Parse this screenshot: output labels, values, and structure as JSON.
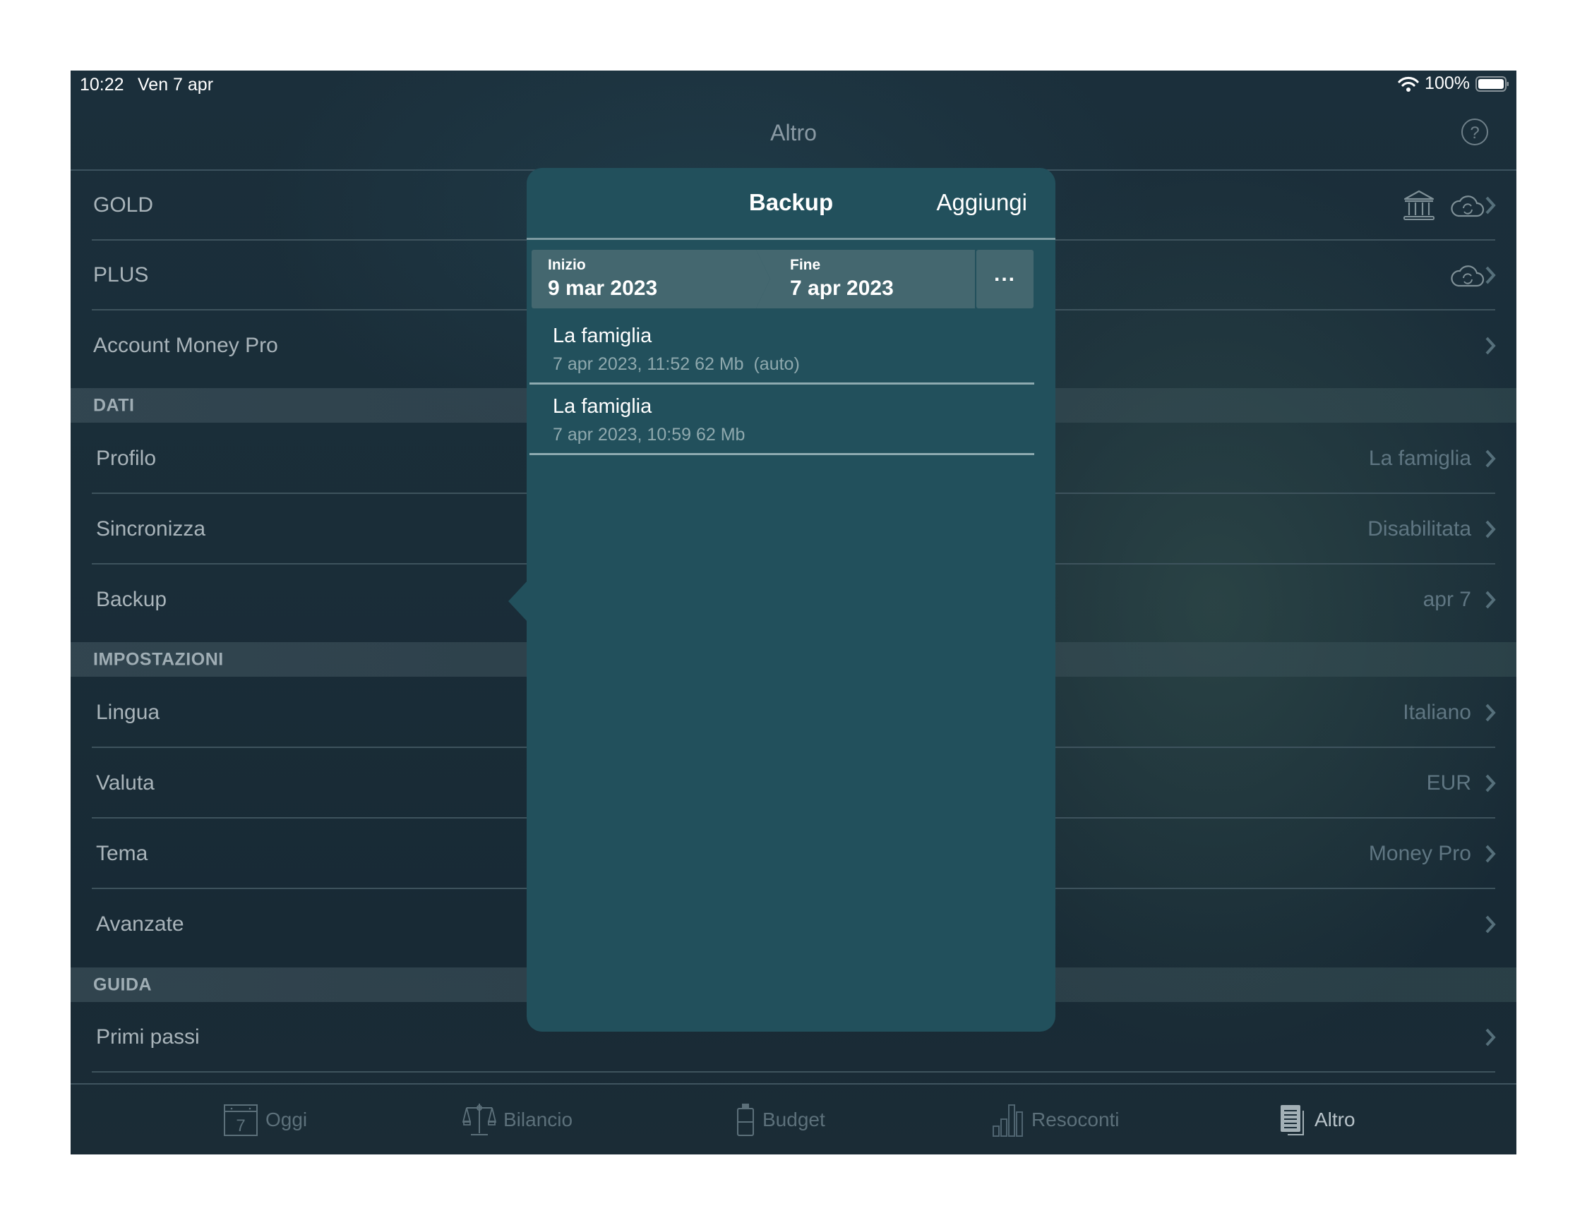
{
  "status_bar": {
    "time": "10:22",
    "date": "Ven 7 apr",
    "battery": "100%",
    "icons": [
      "wifi-icon",
      "battery-icon"
    ]
  },
  "nav": {
    "title": "Altro",
    "help_icon": "question-circle-icon",
    "help_glyph": "?"
  },
  "list": {
    "top_rows": [
      {
        "label": "GOLD",
        "icons": [
          "bank-icon",
          "cloud-sync-icon"
        ]
      },
      {
        "label": "PLUS",
        "icons": [
          "cloud-sync-icon"
        ]
      },
      {
        "label": "Account Money Pro",
        "value": ""
      }
    ],
    "sections": [
      {
        "title": "DATI",
        "rows": [
          {
            "label": "Profilo",
            "value": "La famiglia"
          },
          {
            "label": "Sincronizza",
            "value": "Disabilitata"
          },
          {
            "label": "Backup",
            "value": "apr 7"
          }
        ]
      },
      {
        "title": "IMPOSTAZIONI",
        "rows": [
          {
            "label": "Lingua",
            "value": "Italiano"
          },
          {
            "label": "Valuta",
            "value": "EUR"
          },
          {
            "label": "Tema",
            "value": "Money Pro"
          },
          {
            "label": "Avanzate",
            "value": ""
          }
        ]
      },
      {
        "title": "GUIDA",
        "rows": [
          {
            "label": "Primi passi",
            "value": ""
          }
        ]
      }
    ]
  },
  "tabbar": {
    "tabs": [
      {
        "label": "Oggi",
        "icon": "calendar-icon",
        "icon_text": "7",
        "active": false
      },
      {
        "label": "Bilancio",
        "icon": "scale-icon",
        "active": false
      },
      {
        "label": "Budget",
        "icon": "battery-budget-icon",
        "active": false
      },
      {
        "label": "Resoconti",
        "icon": "bar-chart-icon",
        "active": false
      },
      {
        "label": "Altro",
        "icon": "document-icon",
        "active": true
      }
    ]
  },
  "popover": {
    "title": "Backup",
    "add_label": "Aggiungi",
    "range": {
      "start_caption": "Inizio",
      "start_date": "9 mar 2023",
      "end_caption": "Fine",
      "end_date": "7 apr 2023",
      "more_label": "..."
    },
    "backups": [
      {
        "name": "La famiglia",
        "meta": "7 apr 2023, 11:52 62 Mb  (auto)"
      },
      {
        "name": "La famiglia",
        "meta": "7 apr 2023, 10:59 62 Mb"
      }
    ]
  },
  "colors": {
    "background": "#1a2d38",
    "popover": "#22505c",
    "segment": "#44676f",
    "label_text": "#a9b4ba",
    "value_text": "#5f7682",
    "active_tab": "#b8c3c9"
  }
}
